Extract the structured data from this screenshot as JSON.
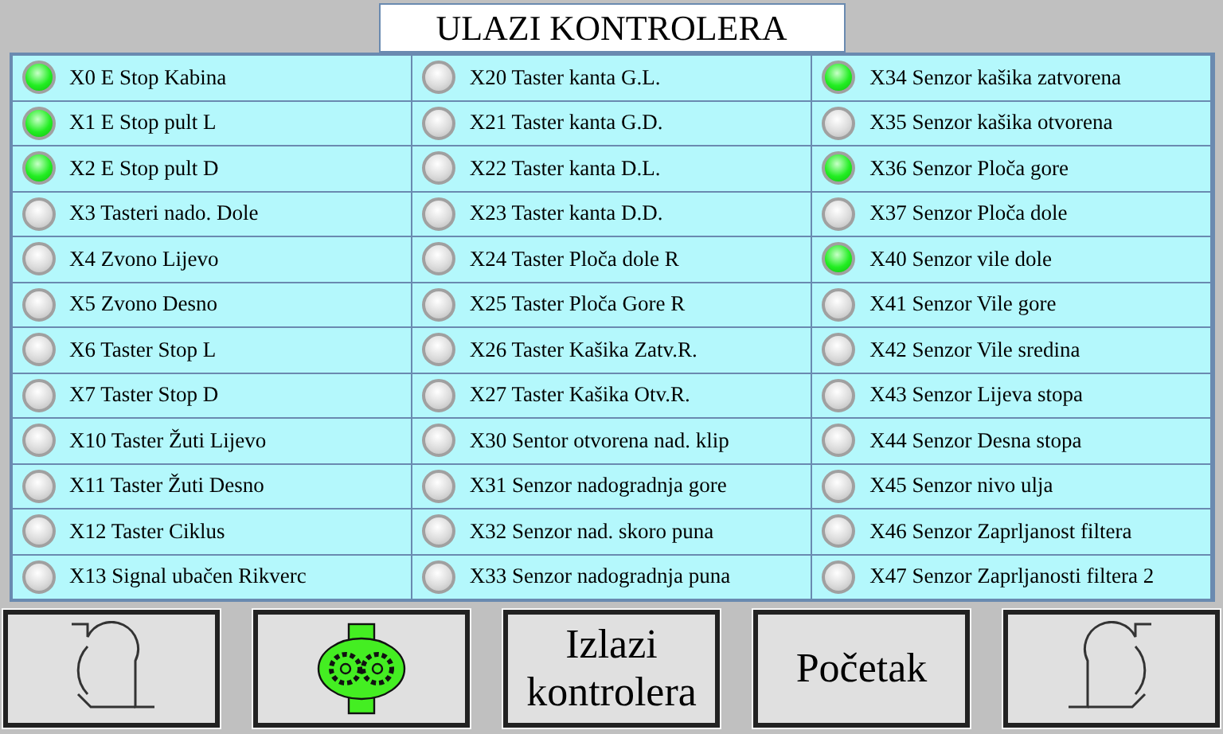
{
  "title": "ULAZI KONTROLERA",
  "columns": [
    [
      {
        "label": "X0 E Stop Kabina",
        "on": true
      },
      {
        "label": "X1 E Stop pult L",
        "on": true
      },
      {
        "label": "X2 E Stop pult D",
        "on": true
      },
      {
        "label": "X3 Tasteri nado. Dole",
        "on": false
      },
      {
        "label": "X4 Zvono Lijevo",
        "on": false
      },
      {
        "label": "X5 Zvono Desno",
        "on": false
      },
      {
        "label": "X6 Taster Stop L",
        "on": false
      },
      {
        "label": "X7 Taster Stop D",
        "on": false
      },
      {
        "label": "X10 Taster Žuti Lijevo",
        "on": false
      },
      {
        "label": "X11 Taster Žuti Desno",
        "on": false
      },
      {
        "label": "X12 Taster Ciklus",
        "on": false
      },
      {
        "label": "X13 Signal ubačen Rikverc",
        "on": false
      }
    ],
    [
      {
        "label": "X20 Taster kanta G.L.",
        "on": false
      },
      {
        "label": "X21 Taster kanta G.D.",
        "on": false
      },
      {
        "label": "X22 Taster kanta D.L.",
        "on": false
      },
      {
        "label": "X23 Taster kanta D.D.",
        "on": false
      },
      {
        "label": "X24 Taster Ploča dole R",
        "on": false
      },
      {
        "label": "X25 Taster Ploča Gore R",
        "on": false
      },
      {
        "label": "X26 Taster Kašika Zatv.R.",
        "on": false
      },
      {
        "label": "X27 Taster Kašika Otv.R.",
        "on": false
      },
      {
        "label": "X30 Sentor otvorena nad. klip",
        "on": false
      },
      {
        "label": "X31 Senzor nadogradnja gore",
        "on": false
      },
      {
        "label": "X32 Senzor nad. skoro puna",
        "on": false
      },
      {
        "label": "X33 Senzor nadogradnja puna",
        "on": false
      }
    ],
    [
      {
        "label": "X34 Senzor kašika zatvorena",
        "on": true
      },
      {
        "label": "X35 Senzor kašika otvorena",
        "on": false
      },
      {
        "label": "X36 Senzor Ploča gore",
        "on": true
      },
      {
        "label": "X37 Senzor Ploča dole",
        "on": false
      },
      {
        "label": "X40 Senzor vile dole",
        "on": true
      },
      {
        "label": "X41 Senzor Vile gore",
        "on": false
      },
      {
        "label": "X42 Senzor Vile sredina",
        "on": false
      },
      {
        "label": "X43 Senzor Lijeva stopa",
        "on": false
      },
      {
        "label": "X44 Senzor Desna stopa",
        "on": false
      },
      {
        "label": "X45 Senzor nivo ulja",
        "on": false
      },
      {
        "label": "X46 Senzor Zaprljanost filtera",
        "on": false
      },
      {
        "label": "X47 Senzor Zaprljanosti filtera 2",
        "on": false
      }
    ]
  ],
  "buttons": [
    {
      "kind": "cabin-left"
    },
    {
      "kind": "pump"
    },
    {
      "kind": "text",
      "label": "Izlazi kontrolera"
    },
    {
      "kind": "text",
      "label": "Početak"
    },
    {
      "kind": "cabin-right"
    }
  ]
}
